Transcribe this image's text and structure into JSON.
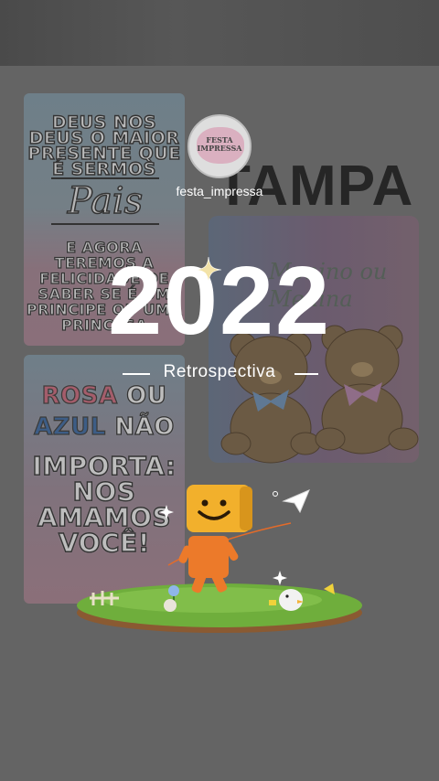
{
  "profile": {
    "username": "festa_impressa",
    "avatar_text": "FESTA IMPRESSA"
  },
  "headline": {
    "year": "2022",
    "subtitle": "Retrospectiva"
  },
  "poster": {
    "card1_line1": "DEUS NOS DEUS O MAIOR PRESENTE QUE É SERMOS",
    "card1_word": "Pais",
    "card1_line2": "E AGORA TEREMOS A FELICIDADE DE SABER SE É UM PRINCIPE OU UMA PRINCESA",
    "card2_rosa": "ROSA",
    "card2_ou": "OU",
    "card2_azul": "AZUL",
    "card2_nao": "NÃO",
    "card2_rest": "IMPORTA: NOS AMAMOS VOCÊ!",
    "right_title": "TAMPA",
    "right_script": "Menino ou Menina"
  },
  "colors": {
    "overlay": "#5e5e5e",
    "white": "#ffffff",
    "grass": "#6fae3c",
    "character": "#f0a22a"
  }
}
